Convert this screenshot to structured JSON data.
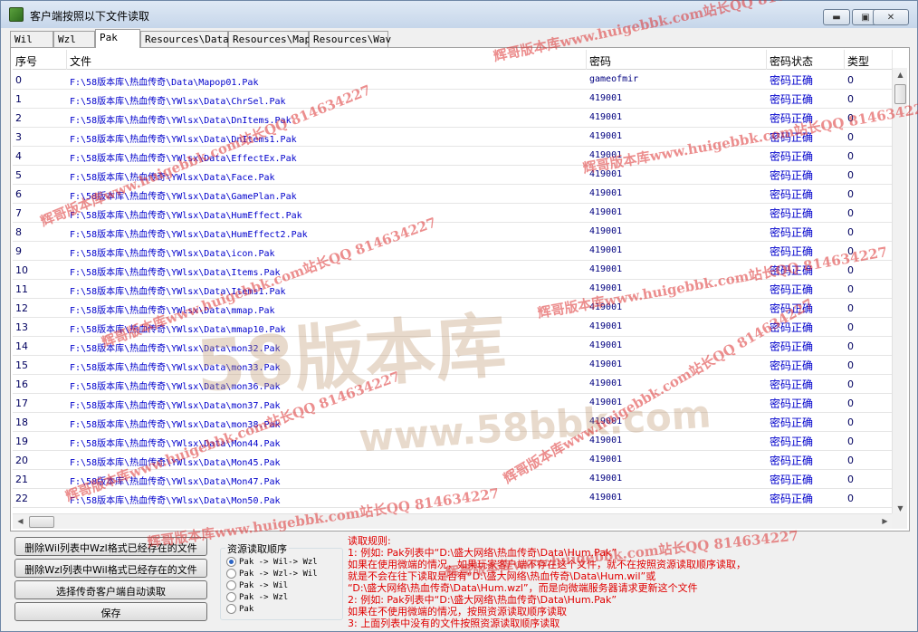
{
  "window": {
    "title": "客户端按照以下文件读取",
    "min_label": "▬",
    "max_label": "▣",
    "close_label": "✕"
  },
  "tabs": [
    {
      "label": "Wil"
    },
    {
      "label": "Wzl"
    },
    {
      "label": "Pak"
    },
    {
      "label": "Resources\\Data"
    },
    {
      "label": "Resources\\Map"
    },
    {
      "label": "Resources\\Wav"
    }
  ],
  "active_tab": "Pak",
  "grid": {
    "columns": [
      "序号",
      "文件",
      "密码",
      "密码状态",
      "类型"
    ],
    "rows": [
      {
        "id": "0",
        "file": "F:\\58版本库\\热血传奇\\Data\\Mapop01.Pak",
        "password": "gameofmir",
        "status": "密码正确",
        "type": "0"
      },
      {
        "id": "1",
        "file": "F:\\58版本库\\热血传奇\\YWlsx\\Data\\ChrSel.Pak",
        "password": "419001",
        "status": "密码正确",
        "type": "0"
      },
      {
        "id": "2",
        "file": "F:\\58版本库\\热血传奇\\YWlsx\\Data\\DnItems.Pak",
        "password": "419001",
        "status": "密码正确",
        "type": "0"
      },
      {
        "id": "3",
        "file": "F:\\58版本库\\热血传奇\\YWlsx\\Data\\DnItems1.Pak",
        "password": "419001",
        "status": "密码正确",
        "type": "0"
      },
      {
        "id": "4",
        "file": "F:\\58版本库\\热血传奇\\YWlsx\\Data\\EffectEx.Pak",
        "password": "419001",
        "status": "密码正确",
        "type": "0"
      },
      {
        "id": "5",
        "file": "F:\\58版本库\\热血传奇\\YWlsx\\Data\\Face.Pak",
        "password": "419001",
        "status": "密码正确",
        "type": "0"
      },
      {
        "id": "6",
        "file": "F:\\58版本库\\热血传奇\\YWlsx\\Data\\GamePlan.Pak",
        "password": "419001",
        "status": "密码正确",
        "type": "0"
      },
      {
        "id": "7",
        "file": "F:\\58版本库\\热血传奇\\YWlsx\\Data\\HumEffect.Pak",
        "password": "419001",
        "status": "密码正确",
        "type": "0"
      },
      {
        "id": "8",
        "file": "F:\\58版本库\\热血传奇\\YWlsx\\Data\\HumEffect2.Pak",
        "password": "419001",
        "status": "密码正确",
        "type": "0"
      },
      {
        "id": "9",
        "file": "F:\\58版本库\\热血传奇\\YWlsx\\Data\\icon.Pak",
        "password": "419001",
        "status": "密码正确",
        "type": "0"
      },
      {
        "id": "10",
        "file": "F:\\58版本库\\热血传奇\\YWlsx\\Data\\Items.Pak",
        "password": "419001",
        "status": "密码正确",
        "type": "0"
      },
      {
        "id": "11",
        "file": "F:\\58版本库\\热血传奇\\YWlsx\\Data\\Items1.Pak",
        "password": "419001",
        "status": "密码正确",
        "type": "0"
      },
      {
        "id": "12",
        "file": "F:\\58版本库\\热血传奇\\YWlsx\\Data\\mmap.Pak",
        "password": "419001",
        "status": "密码正确",
        "type": "0"
      },
      {
        "id": "13",
        "file": "F:\\58版本库\\热血传奇\\YWlsx\\Data\\mmap10.Pak",
        "password": "419001",
        "status": "密码正确",
        "type": "0"
      },
      {
        "id": "14",
        "file": "F:\\58版本库\\热血传奇\\YWlsx\\Data\\mon32.Pak",
        "password": "419001",
        "status": "密码正确",
        "type": "0"
      },
      {
        "id": "15",
        "file": "F:\\58版本库\\热血传奇\\YWlsx\\Data\\mon33.Pak",
        "password": "419001",
        "status": "密码正确",
        "type": "0"
      },
      {
        "id": "16",
        "file": "F:\\58版本库\\热血传奇\\YWlsx\\Data\\mon36.Pak",
        "password": "419001",
        "status": "密码正确",
        "type": "0"
      },
      {
        "id": "17",
        "file": "F:\\58版本库\\热血传奇\\YWlsx\\Data\\mon37.Pak",
        "password": "419001",
        "status": "密码正确",
        "type": "0"
      },
      {
        "id": "18",
        "file": "F:\\58版本库\\热血传奇\\YWlsx\\Data\\mon38.Pak",
        "password": "419001",
        "status": "密码正确",
        "type": "0"
      },
      {
        "id": "19",
        "file": "F:\\58版本库\\热血传奇\\YWlsx\\Data\\Mon44.Pak",
        "password": "419001",
        "status": "密码正确",
        "type": "0"
      },
      {
        "id": "20",
        "file": "F:\\58版本库\\热血传奇\\YWlsx\\Data\\Mon45.Pak",
        "password": "419001",
        "status": "密码正确",
        "type": "0"
      },
      {
        "id": "21",
        "file": "F:\\58版本库\\热血传奇\\YWlsx\\Data\\Mon47.Pak",
        "password": "419001",
        "status": "密码正确",
        "type": "0"
      },
      {
        "id": "22",
        "file": "F:\\58版本库\\热血传奇\\YWlsx\\Data\\Mon50.Pak",
        "password": "419001",
        "status": "密码正确",
        "type": "0"
      }
    ]
  },
  "buttons": {
    "delete_wil": "删除Wil列表中Wzl格式已经存在的文件",
    "delete_wzl": "删除Wzl列表中Wil格式已经存在的文件",
    "choose_client": "选择传奇客户端自动读取",
    "save": "保存"
  },
  "resource_order": {
    "title": "资源读取顺序",
    "options": [
      {
        "label": "Pak -> Wil-> Wzl",
        "selected": true
      },
      {
        "label": "Pak -> Wzl-> Wil",
        "selected": false
      },
      {
        "label": "Pak -> Wil",
        "selected": false
      },
      {
        "label": "Pak -> Wzl",
        "selected": false
      },
      {
        "label": "Pak",
        "selected": false
      }
    ]
  },
  "rules": {
    "heading": "读取规则:",
    "lines": [
      "1: 例如: Pak列表中“D:\\盛大网络\\热血传奇\\Data\\Hum.Pak”",
      "   如果在使用微端的情况，如果玩家客户端不存在这个文件，就不在按照资源读取顺序读取，",
      "   就是不会在往下读取是否有“D:\\盛大网络\\热血传奇\\Data\\Hum.wil”或",
      "   “D:\\盛大网络\\热血传奇\\Data\\Hum.wzl”，而是向微端服务器请求更新这个文件",
      "2: 例如: Pak列表中“D:\\盛大网络\\热血传奇\\Data\\Hum.Pak”",
      "   如果在不使用微端的情况，按照资源读取顺序读取",
      "3: 上面列表中没有的文件按照资源读取顺序读取"
    ]
  },
  "watermarks": {
    "site_cn": "辉哥版本库www.huigebbk.com站长QQ 814634227",
    "brand": "58版本库",
    "brand_url": "www.58bbk.com"
  },
  "colors": {
    "file_text": "#0000cc",
    "status_text": "#0000cc",
    "rules_text": "#e00000"
  }
}
